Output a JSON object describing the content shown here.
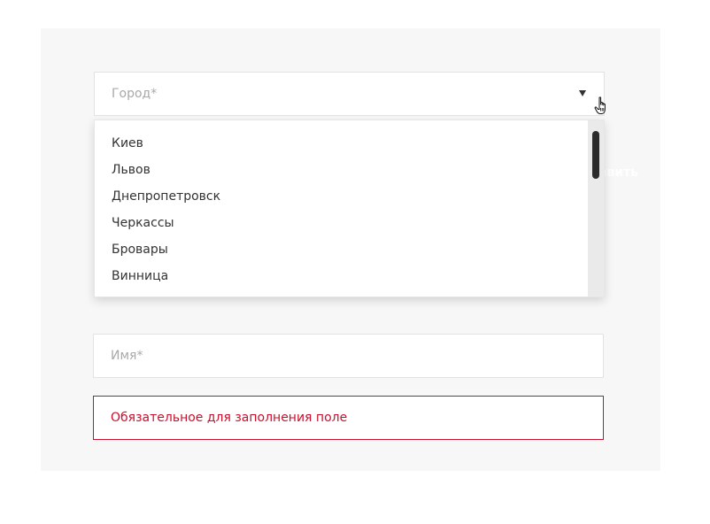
{
  "city_select": {
    "placeholder": "Город*",
    "options": [
      "Киев",
      "Львов",
      "Днепропетровск",
      "Черкассы",
      "Бровары",
      "Винница"
    ]
  },
  "hidden_label": "авить",
  "name_field": {
    "placeholder": "Имя*",
    "value": ""
  },
  "validation": {
    "message": "Обязательное для заполнения поле"
  },
  "colors": {
    "panel_bg": "#f7f7f7",
    "error": "#c8102e",
    "text": "#333333",
    "placeholder": "#a9a9a9"
  },
  "icons": {
    "caret": "caret-down-icon",
    "cursor": "hand-pointer-icon"
  }
}
